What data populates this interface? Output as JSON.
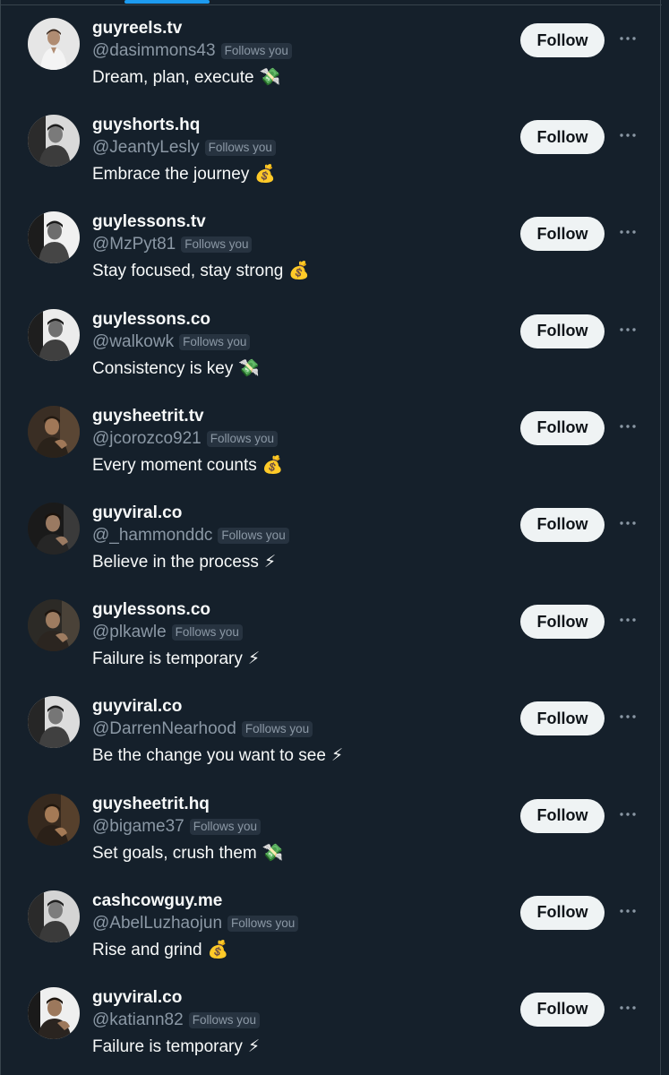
{
  "icons": {
    "more": "more-horizontal-icon",
    "cash": "money-with-wings-icon",
    "bag": "money-bag-icon",
    "bolt": "lightning-icon"
  },
  "colors": {
    "background": "#15202b",
    "accent": "#1d9bf0",
    "button_bg": "#eff3f4",
    "secondary_text": "#8b98a5"
  },
  "users": [
    {
      "name": "guyreels.tv",
      "handle": "@dasimmons43",
      "badge": "Follows you",
      "bio": "Dream, plan, execute",
      "emoji": "💸",
      "follow_label": "Follow"
    },
    {
      "name": "guyshorts.hq",
      "handle": "@JeantyLesly",
      "badge": "Follows you",
      "bio": "Embrace the journey",
      "emoji": "💰",
      "follow_label": "Follow"
    },
    {
      "name": "guylessons.tv",
      "handle": "@MzPyt81",
      "badge": "Follows you",
      "bio": "Stay focused, stay strong",
      "emoji": "💰",
      "follow_label": "Follow"
    },
    {
      "name": "guylessons.co",
      "handle": "@walkowk",
      "badge": "Follows you",
      "bio": "Consistency is key",
      "emoji": "💸",
      "follow_label": "Follow"
    },
    {
      "name": "guysheetrit.tv",
      "handle": "@jcorozco921",
      "badge": "Follows you",
      "bio": "Every moment counts",
      "emoji": "💰",
      "follow_label": "Follow"
    },
    {
      "name": "guyviral.co",
      "handle": "@_hammonddc",
      "badge": "Follows you",
      "bio": "Believe in the process",
      "emoji": "⚡",
      "follow_label": "Follow"
    },
    {
      "name": "guylessons.co",
      "handle": "@plkawle",
      "badge": "Follows you",
      "bio": "Failure is temporary",
      "emoji": "⚡",
      "follow_label": "Follow"
    },
    {
      "name": "guyviral.co",
      "handle": "@DarrenNearhood",
      "badge": "Follows you",
      "bio": "Be the change you want to see",
      "emoji": "⚡",
      "follow_label": "Follow"
    },
    {
      "name": "guysheetrit.hq",
      "handle": "@bigame37",
      "badge": "Follows you",
      "bio": "Set goals, crush them",
      "emoji": "💸",
      "follow_label": "Follow"
    },
    {
      "name": "cashcowguy.me",
      "handle": "@AbelLuzhaojun",
      "badge": "Follows you",
      "bio": "Rise and grind",
      "emoji": "💰",
      "follow_label": "Follow"
    },
    {
      "name": "guyviral.co",
      "handle": "@katiann82",
      "badge": "Follows you",
      "bio": "Failure is temporary",
      "emoji": "⚡",
      "follow_label": "Follow"
    }
  ]
}
